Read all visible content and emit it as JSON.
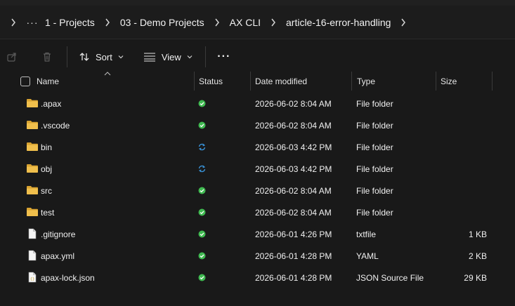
{
  "breadcrumb": {
    "more_label": "···",
    "items": [
      "1 - Projects",
      "03 - Demo Projects",
      "AX CLI",
      "article-16-error-handling"
    ]
  },
  "toolbar": {
    "sort_label": "Sort",
    "view_label": "View",
    "more_label": "···"
  },
  "columns": {
    "name": "Name",
    "status": "Status",
    "date": "Date modified",
    "type": "Type",
    "size": "Size"
  },
  "colors": {
    "synced": "#3fb950",
    "syncing": "#3a96dd",
    "folder": "#e8b544"
  },
  "files": [
    {
      "name": ".apax",
      "icon": "folder-icon",
      "status": "synced",
      "date": "2026-06-02 8:04 AM",
      "type": "File folder",
      "size": ""
    },
    {
      "name": ".vscode",
      "icon": "folder-icon",
      "status": "synced",
      "date": "2026-06-02 8:04 AM",
      "type": "File folder",
      "size": ""
    },
    {
      "name": "bin",
      "icon": "folder-icon",
      "status": "syncing",
      "date": "2026-06-03 4:42 PM",
      "type": "File folder",
      "size": ""
    },
    {
      "name": "obj",
      "icon": "folder-icon",
      "status": "syncing",
      "date": "2026-06-03 4:42 PM",
      "type": "File folder",
      "size": ""
    },
    {
      "name": "src",
      "icon": "folder-icon",
      "status": "synced",
      "date": "2026-06-02 8:04 AM",
      "type": "File folder",
      "size": ""
    },
    {
      "name": "test",
      "icon": "folder-icon",
      "status": "synced",
      "date": "2026-06-02 8:04 AM",
      "type": "File folder",
      "size": ""
    },
    {
      "name": ".gitignore",
      "icon": "file-icon",
      "status": "synced",
      "date": "2026-06-01 4:26 PM",
      "type": "txtfile",
      "size": "1 KB"
    },
    {
      "name": "apax.yml",
      "icon": "file-icon",
      "status": "synced",
      "date": "2026-06-01 4:28 PM",
      "type": "YAML",
      "size": "2 KB"
    },
    {
      "name": "apax-lock.json",
      "icon": "json-file-icon",
      "status": "synced",
      "date": "2026-06-01 4:28 PM",
      "type": "JSON Source File",
      "size": "29 KB"
    }
  ]
}
